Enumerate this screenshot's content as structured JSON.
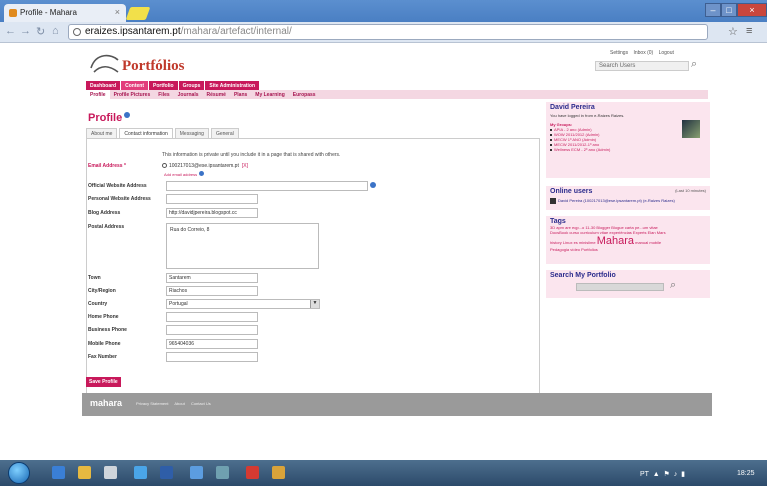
{
  "browser": {
    "tab_title": "Profile - Mahara",
    "url_host": "eraizes.ipsantarem.pt",
    "url_path": "/mahara/artefact/internal/"
  },
  "header": {
    "brand": "Portfólios",
    "settings": "Settings",
    "inbox": "Inbox (0)",
    "logout": "Logout",
    "search_placeholder": "Search Users"
  },
  "main_nav": [
    "Dashboard",
    "Content",
    "Portfolio",
    "Groups",
    "Site Administration"
  ],
  "sub_nav": [
    "Profile",
    "Profile Pictures",
    "Files",
    "Journals",
    "Résumé",
    "Plans",
    "My Learning",
    "Europass"
  ],
  "page_title": "Profile",
  "profile_tabs": [
    "About me",
    "Contact information",
    "Messaging",
    "General"
  ],
  "info_text": "This information is private until you include it in a page that is shared with others.",
  "email": {
    "label": "Email Address *",
    "value": "100217013@ese.ipsantarem.pt",
    "delete": "[X]",
    "add_link": "Add email address"
  },
  "fields": [
    {
      "label": "Official Website Address",
      "value": ""
    },
    {
      "label": "Personal Website Address",
      "value": ""
    },
    {
      "label": "Blog Address",
      "value": "http://davidjpereira.blogspot.cc"
    },
    {
      "label": "Postal Address",
      "value": "Rua do Correio, 8"
    },
    {
      "label": "Town",
      "value": "Santarem"
    },
    {
      "label": "City/Region",
      "value": "Riachos"
    },
    {
      "label": "Country",
      "value": "Portugal"
    },
    {
      "label": "Home Phone",
      "value": ""
    },
    {
      "label": "Business Phone",
      "value": ""
    },
    {
      "label": "Mobile Phone",
      "value": "965404036"
    },
    {
      "label": "Fax Number",
      "value": ""
    }
  ],
  "save_button": "Save Profile",
  "footer": {
    "mahara_logo": "mahara",
    "links": [
      "Privacy Statement",
      "About",
      "Contact Us"
    ]
  },
  "sidebar": {
    "user_name": "David Pereira",
    "logged_in_text": "You have logged in from e-Raizes Raizes.",
    "groups_title": "My Groups:",
    "groups": [
      "APIA - 2 ano (Admin)",
      "WOW 2011/2012 (Admin)",
      "MECW 1º ANO (Admin)",
      "MECW 2011/2012-1º ano",
      "Wellness ECM - 2º ano (Admin)"
    ],
    "online_title": "Online users",
    "online_note": "(Last 10 minutes)",
    "online_user": "David Pereira (100217013@ese.ipsantarem.pt) (e-Raizes Raizes)",
    "tags_title": "Tags",
    "tags_line1": "3D  apm  are eqp...o 11-30  Blogger  Blogue  carta pe...um vitae",
    "tags_line2": "DocsBook  curso  curriculum vitae  experiências  Experts  Elan Mars",
    "tags_big": "Mahara",
    "tags_line3": "history  Linux es  minislime",
    "tags_line3b": "manual  mobile",
    "tags_line4": "Pedagogia  vídeo  Portfolios",
    "search_title": "Search My Portfolio"
  },
  "taskbar": {
    "tray_text": "PT",
    "clock": "18:25"
  }
}
